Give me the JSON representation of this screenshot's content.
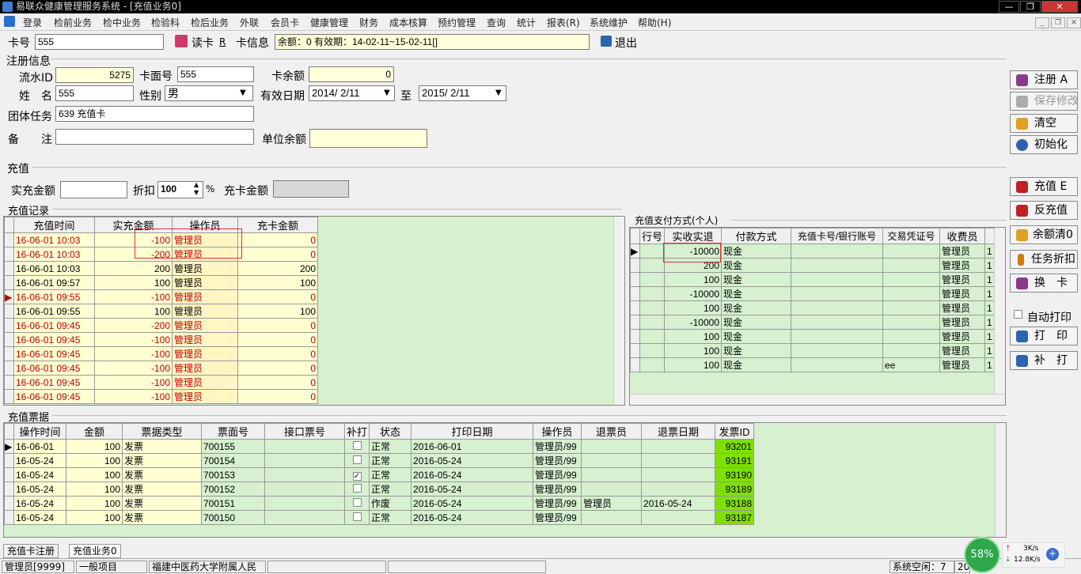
{
  "window": {
    "title": "易联众健康管理服务系统 - [充值业务0]",
    "min": "—",
    "max": "❐",
    "close": "✕"
  },
  "menu": [
    "登录",
    "检前业务",
    "检中业务",
    "检验科",
    "检后业务",
    "外联",
    "会员卡",
    "健康管理",
    "财务",
    "成本核算",
    "预约管理",
    "查询",
    "统计",
    "报表(R)",
    "系统维护",
    "帮助(H)"
  ],
  "topbar": {
    "card_no_label": "卡号",
    "card_no": "555",
    "read_card": "读卡",
    "read_card_key": "R",
    "card_info_label": "卡信息",
    "card_info": "余额：0 有效期：14-02-11~15-02-11[]",
    "exit": "退出"
  },
  "reg": {
    "section": "注册信息",
    "flow_id_label": "流水ID",
    "flow_id": "5275",
    "face_no_label": "卡面号",
    "face_no": "555",
    "balance_label": "卡余额",
    "balance": "0",
    "name_label": "姓　名",
    "name": "555",
    "gender_label": "性别",
    "gender": "男",
    "valid_label": "有效日期",
    "valid_from": "2014/ 2/11",
    "to_label": "至",
    "valid_to": "2015/ 2/11",
    "group_label": "团体任务",
    "group": "639 充值卡",
    "note_label": "备　　注",
    "note": "",
    "unit_balance_label": "单位余额",
    "unit_balance": ""
  },
  "right_buttons": {
    "register": "注册 A",
    "save": "保存修改",
    "clear": "清空",
    "init": "初始化",
    "recharge": "充值 E",
    "reverse": "反充值",
    "clear_balance": "余额清0",
    "task_discount": "任务折扣",
    "swap": "换　卡",
    "auto_print": "自动打印",
    "print": "打　印",
    "reprint": "补　打"
  },
  "recharge": {
    "section": "充值",
    "actual_label": "实充金额",
    "actual": "",
    "discount_label": "折扣",
    "discount": "100",
    "percent": "%",
    "card_amount_label": "充卡金额",
    "card_amount": ""
  },
  "records": {
    "section": "充值记录",
    "headers": [
      "充值时间",
      "实充金额",
      "操作员",
      "充卡金额"
    ],
    "rows": [
      {
        "time": "16-06-01 10:03",
        "amt": "-100",
        "op": "管理员",
        "card": "0",
        "red": true
      },
      {
        "time": "16-06-01 10:03",
        "amt": "-200",
        "op": "管理员",
        "card": "0",
        "red": true
      },
      {
        "time": "16-06-01 10:03",
        "amt": "200",
        "op": "管理员",
        "card": "200",
        "red": false
      },
      {
        "time": "16-06-01 09:57",
        "amt": "100",
        "op": "管理员",
        "card": "100",
        "red": false
      },
      {
        "time": "16-06-01 09:55",
        "amt": "-100",
        "op": "管理员",
        "card": "0",
        "red": true
      },
      {
        "time": "16-06-01 09:55",
        "amt": "100",
        "op": "管理员",
        "card": "100",
        "red": false
      },
      {
        "time": "16-06-01 09:45",
        "amt": "-200",
        "op": "管理员",
        "card": "0",
        "red": true
      },
      {
        "time": "16-06-01 09:45",
        "amt": "-100",
        "op": "管理员",
        "card": "0",
        "red": true
      },
      {
        "time": "16-06-01 09:45",
        "amt": "-100",
        "op": "管理员",
        "card": "0",
        "red": true
      },
      {
        "time": "16-06-01 09:45",
        "amt": "-100",
        "op": "管理员",
        "card": "0",
        "red": true
      },
      {
        "time": "16-06-01 09:45",
        "amt": "-100",
        "op": "管理员",
        "card": "0",
        "red": true
      },
      {
        "time": "16-06-01 09:45",
        "amt": "-100",
        "op": "管理员",
        "card": "0",
        "red": true
      }
    ]
  },
  "payments": {
    "section": "充值支付方式(个人)",
    "headers": [
      "行号",
      "实收实退",
      "付款方式",
      "充值卡号/银行账号",
      "交易凭证号",
      "收费员",
      ""
    ],
    "rows": [
      {
        "amt": "-10000",
        "method": "现金",
        "acct": "",
        "voucher": "",
        "cashier": "管理员",
        "x": "1"
      },
      {
        "amt": "200",
        "method": "现金",
        "acct": "",
        "voucher": "",
        "cashier": "管理员",
        "x": "1"
      },
      {
        "amt": "100",
        "method": "现金",
        "acct": "",
        "voucher": "",
        "cashier": "管理员",
        "x": "1"
      },
      {
        "amt": "-10000",
        "method": "现金",
        "acct": "",
        "voucher": "",
        "cashier": "管理员",
        "x": "1"
      },
      {
        "amt": "100",
        "method": "现金",
        "acct": "",
        "voucher": "",
        "cashier": "管理员",
        "x": "1"
      },
      {
        "amt": "-10000",
        "method": "现金",
        "acct": "",
        "voucher": "",
        "cashier": "管理员",
        "x": "1"
      },
      {
        "amt": "100",
        "method": "现金",
        "acct": "",
        "voucher": "",
        "cashier": "管理员",
        "x": "1"
      },
      {
        "amt": "100",
        "method": "现金",
        "acct": "",
        "voucher": "",
        "cashier": "管理员",
        "x": "1"
      },
      {
        "amt": "100",
        "method": "现金",
        "acct": "",
        "voucher": "ee",
        "cashier": "管理员",
        "x": "1"
      }
    ]
  },
  "invoices": {
    "section": "充值票据",
    "headers": [
      "操作时间",
      "金额",
      "票据类型",
      "票面号",
      "接口票号",
      "补打",
      "状态",
      "打印日期",
      "操作员",
      "退票员",
      "退票日期",
      "发票ID"
    ],
    "rows": [
      {
        "date": "16-06-01",
        "amt": "100",
        "type": "发票",
        "no": "700155",
        "iface": "",
        "reprint": false,
        "status": "正常",
        "pdate": "2016-06-01",
        "op": "管理员/99",
        "refunder": "",
        "rdate": "",
        "id": "93201"
      },
      {
        "date": "16-05-24",
        "amt": "100",
        "type": "发票",
        "no": "700154",
        "iface": "",
        "reprint": false,
        "status": "正常",
        "pdate": "2016-05-24",
        "op": "管理员/99",
        "refunder": "",
        "rdate": "",
        "id": "93191"
      },
      {
        "date": "16-05-24",
        "amt": "100",
        "type": "发票",
        "no": "700153",
        "iface": "",
        "reprint": true,
        "status": "正常",
        "pdate": "2016-05-24",
        "op": "管理员/99",
        "refunder": "",
        "rdate": "",
        "id": "93190"
      },
      {
        "date": "16-05-24",
        "amt": "100",
        "type": "发票",
        "no": "700152",
        "iface": "",
        "reprint": false,
        "status": "正常",
        "pdate": "2016-05-24",
        "op": "管理员/99",
        "refunder": "",
        "rdate": "",
        "id": "93189"
      },
      {
        "date": "16-05-24",
        "amt": "100",
        "type": "发票",
        "no": "700151",
        "iface": "",
        "reprint": false,
        "status": "作废",
        "pdate": "2016-05-24",
        "op": "管理员/99",
        "refunder": "管理员",
        "rdate": "2016-05-24",
        "id": "93188"
      },
      {
        "date": "16-05-24",
        "amt": "100",
        "type": "发票",
        "no": "700150",
        "iface": "",
        "reprint": false,
        "status": "正常",
        "pdate": "2016-05-24",
        "op": "管理员/99",
        "refunder": "",
        "rdate": "",
        "id": "93187"
      }
    ]
  },
  "tabs": [
    "充值卡注册",
    "充值业务0"
  ],
  "status": {
    "user": "管理员[9999]",
    "project": "一般项目",
    "org": "福建中医药大学附属人民",
    "idle": "系统空闲：7",
    "year": "20",
    "cpu": "58%",
    "up": "3K/s",
    "down": "12.8K/s"
  }
}
